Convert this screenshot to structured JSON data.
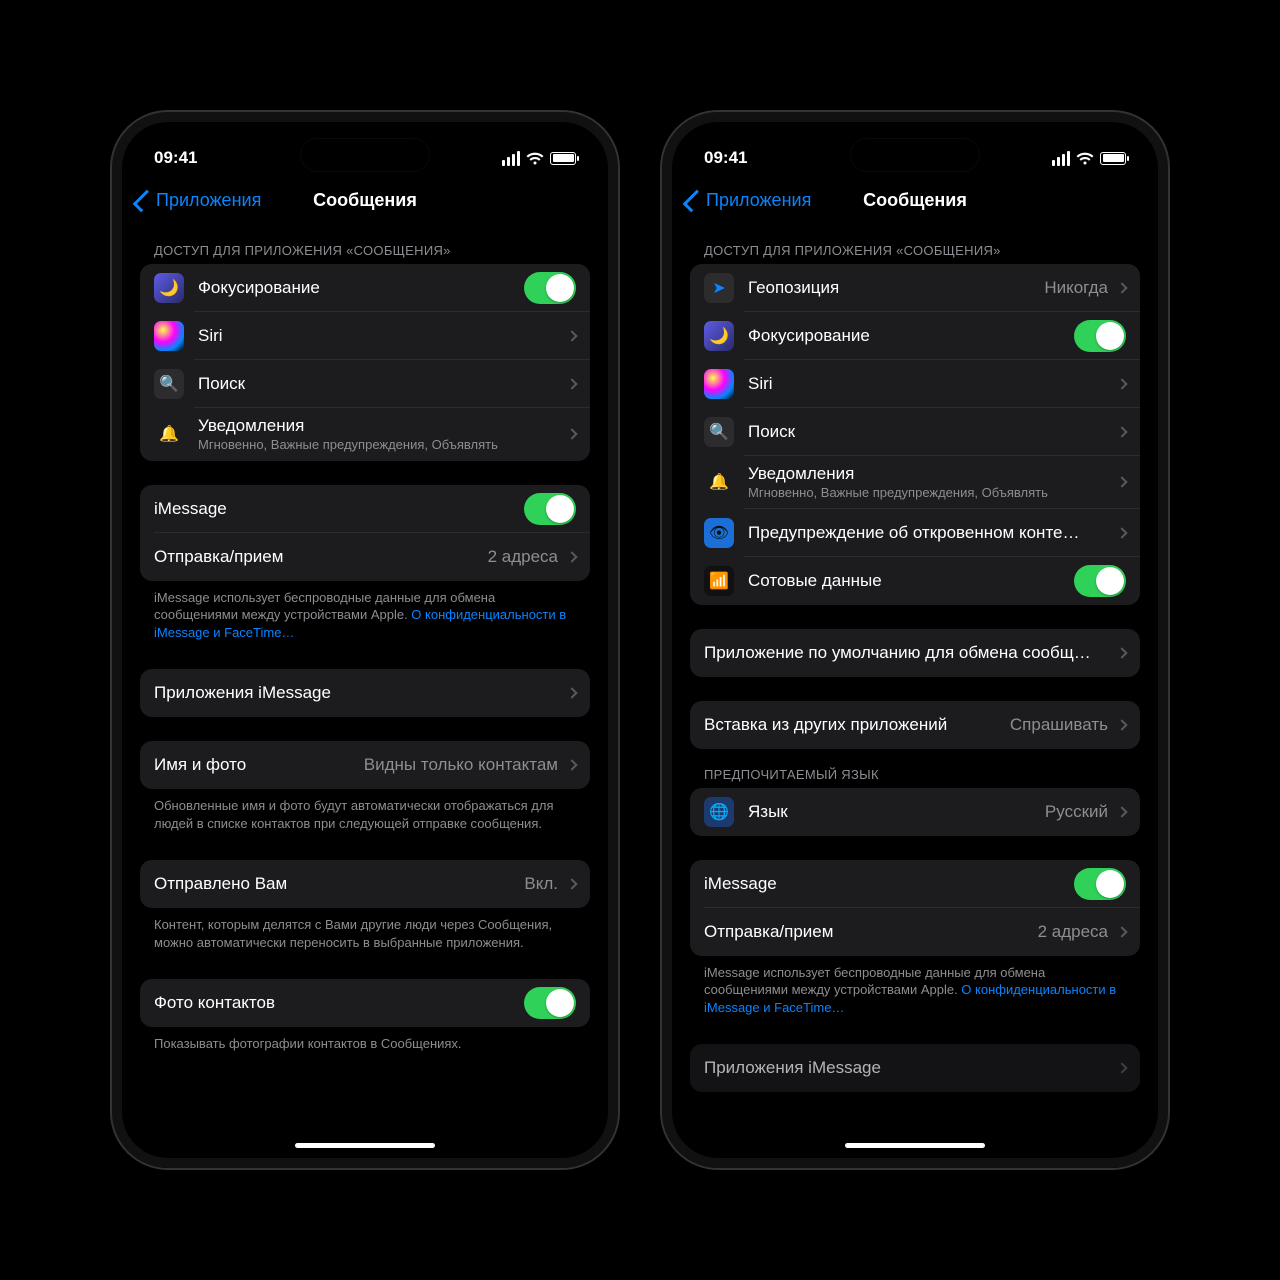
{
  "status": {
    "time": "09:41"
  },
  "nav": {
    "back": "Приложения",
    "title": "Сообщения"
  },
  "left": {
    "section1_header": "ДОСТУП ДЛЯ ПРИЛОЖЕНИЯ «СООБЩЕНИЯ»",
    "focus": "Фокусирование",
    "siri": "Siri",
    "search": "Поиск",
    "notif_label": "Уведомления",
    "notif_sub": "Мгновенно, Важные предупреждения, Объявлять",
    "imessage": "iMessage",
    "sendrecv": "Отправка/прием",
    "sendrecv_val": "2 адреса",
    "imessage_foot_a": "iMessage использует беспроводные данные для обмена сообщениями между устройствами Apple. ",
    "imessage_foot_link": "О конфиденци­альности в iMessage и FaceTime…",
    "imsg_apps": "Приложения iMessage",
    "name_photo": "Имя и фото",
    "name_photo_val": "Видны только контактам",
    "name_photo_foot": "Обновленные имя и фото будут автоматически отобра­жаться для людей в списке контактов при следующей отправке сообщения.",
    "shared": "Отправлено Вам",
    "shared_val": "Вкл.",
    "shared_foot": "Контент, которым делятся с Вами другие люди через Сообщения, можно автоматически переносить в выбранные приложения.",
    "contact_photos": "Фото контактов",
    "contact_photos_foot": "Показывать фотографии контактов в Сообщениях."
  },
  "right": {
    "section1_header": "ДОСТУП ДЛЯ ПРИЛОЖЕНИЯ «СООБЩЕНИЯ»",
    "location": "Геопозиция",
    "location_val": "Никогда",
    "focus": "Фокусирование",
    "siri": "Siri",
    "search": "Поиск",
    "notif_label": "Уведомления",
    "notif_sub": "Мгновенно, Важные предупреждения, Объявлять",
    "sensitive": "Предупреждение об откровенном конте…",
    "cellular": "Сотовые данные",
    "default_app": "Приложение по умолчанию для обмена сообщ…",
    "paste": "Вставка из других приложений",
    "paste_val": "Спрашивать",
    "lang_header": "ПРЕДПОЧИТАЕМЫЙ ЯЗЫК",
    "lang": "Язык",
    "lang_val": "Русский",
    "imessage": "iMessage",
    "sendrecv": "Отправка/прием",
    "sendrecv_val": "2 адреса",
    "imessage_foot_a": "iMessage использует беспроводные данные для обмена сообщениями между устройствами Apple. ",
    "imessage_foot_link": "О конфиденци­альности в iMessage и FaceTime…",
    "imsg_apps": "Приложения iMessage"
  }
}
